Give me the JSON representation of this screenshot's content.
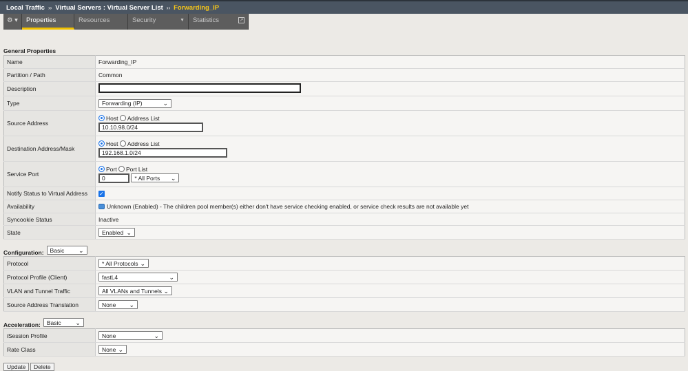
{
  "breadcrumb": {
    "a": "Local Traffic",
    "b": "Virtual Servers : Virtual Server List",
    "current": "Forwarding_IP",
    "sep": "››"
  },
  "tabs": [
    {
      "label": "Properties"
    },
    {
      "label": "Resources"
    },
    {
      "label": "Security"
    },
    {
      "label": "Statistics"
    }
  ],
  "general": {
    "title": "General Properties",
    "name_label": "Name",
    "name": "Forwarding_IP",
    "partition_label": "Partition / Path",
    "partition": "Common",
    "description_label": "Description",
    "description": "",
    "type_label": "Type",
    "type": "Forwarding (IP)",
    "source_label": "Source Address",
    "source": "10.10.98.0/24",
    "dest_label": "Destination Address/Mask",
    "dest": "192.168.1.0/24",
    "host": "Host",
    "address_list": "Address List",
    "port_label": "Service Port",
    "port_opt": "Port",
    "port_list_opt": "Port List",
    "port": "0",
    "port_select": "* All Ports",
    "notify_label": "Notify Status to Virtual Address",
    "availability_label": "Availability",
    "availability": "Unknown (Enabled) - The children pool member(s) either don't have service checking enabled, or service check results are not available yet",
    "syncookie_label": "Syncookie Status",
    "syncookie": "Inactive",
    "state_label": "State",
    "state": "Enabled"
  },
  "config": {
    "title": "Configuration:",
    "mode": "Basic",
    "protocol_label": "Protocol",
    "protocol": "* All Protocols",
    "profile_label": "Protocol Profile (Client)",
    "profile": "fastL4",
    "vlan_label": "VLAN and Tunnel Traffic",
    "vlan": "All VLANs and Tunnels",
    "snat_label": "Source Address Translation",
    "snat": "None"
  },
  "accel": {
    "title": "Acceleration:",
    "mode": "Basic",
    "isession_label": "iSession Profile",
    "isession": "None",
    "rate_label": "Rate Class",
    "rate": "None"
  },
  "buttons": {
    "update": "Update",
    "delete": "Delete"
  }
}
